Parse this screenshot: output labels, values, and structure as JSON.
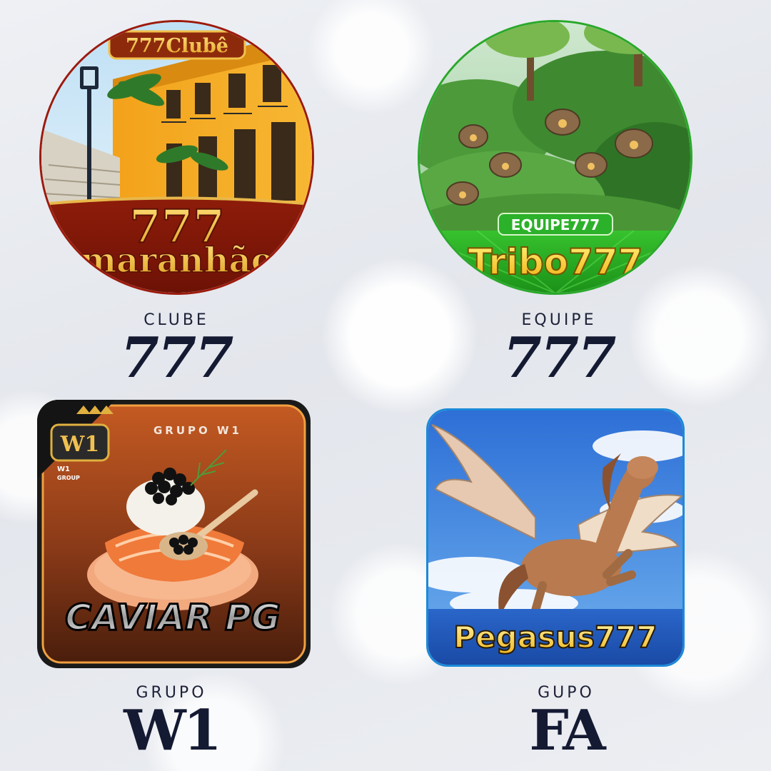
{
  "items": [
    {
      "badge": "777Clubê",
      "title_line1": "777",
      "title_line2": "maranhão",
      "caption_small": "CLUBE",
      "caption_big": "777"
    },
    {
      "badge": "EQUIPE777",
      "title": "Tribo777",
      "caption_small": "EQUIPE",
      "caption_big": "777"
    },
    {
      "group_label": "GRUPO W1",
      "logo_text": "W1",
      "logo_sub1": "W1",
      "logo_sub2": "GROUP",
      "title": "CAVIAR PG",
      "caption_small": "GRUPO",
      "caption_big": "W1"
    },
    {
      "title": "Pegasus777",
      "caption_small": "GUPO",
      "caption_big": "FA"
    }
  ],
  "colors": {
    "caption": "#151a33",
    "maranhao_red": "#7a1508",
    "tribo_green": "#1e9b1e",
    "caviar_brown": "#7a3a1a",
    "pegasus_blue": "#1d5fd0"
  }
}
